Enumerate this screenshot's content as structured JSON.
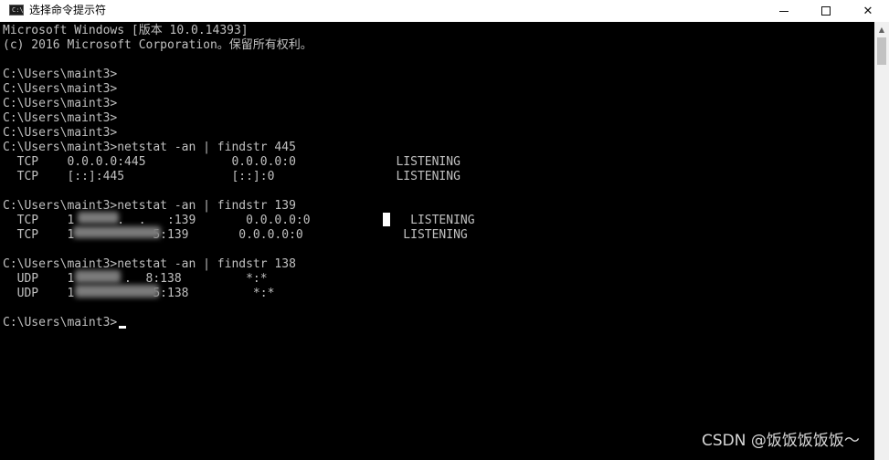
{
  "window": {
    "title": "选择命令提示符",
    "icon": "cmd-icon",
    "icon_text": "C:\\",
    "minimize_glyph": "minimize-icon",
    "maximize_glyph": "maximize-icon",
    "close_glyph": "✕"
  },
  "console": {
    "lines": [
      "Microsoft Windows [版本 10.0.14393]",
      "(c) 2016 Microsoft Corporation。保留所有权利。",
      "",
      "C:\\Users\\maint3>",
      "C:\\Users\\maint3>",
      "C:\\Users\\maint3>",
      "C:\\Users\\maint3>",
      "C:\\Users\\maint3>",
      "C:\\Users\\maint3>netstat -an | findstr 445",
      "  TCP    0.0.0.0:445            0.0.0.0:0              LISTENING",
      "  TCP    [::]:445               [::]:0                 LISTENING",
      "",
      "C:\\Users\\maint3>netstat -an | findstr 139",
      "  TCP    1      .  .   :139       0.0.0.0:0              LISTENING",
      "  TCP    1           5:139       0.0.0.0:0              LISTENING",
      "",
      "C:\\Users\\maint3>netstat -an | findstr 138",
      "  UDP    1       .  8:138         *:*",
      "  UDP    1           5:138         *:*",
      "",
      "C:\\Users\\maint3>"
    ],
    "text_color": "#c0c0c0",
    "background": "#000000"
  },
  "scrollbar": {
    "up_arrow": "▲"
  },
  "watermark": "CSDN @饭饭饭饭饭～"
}
